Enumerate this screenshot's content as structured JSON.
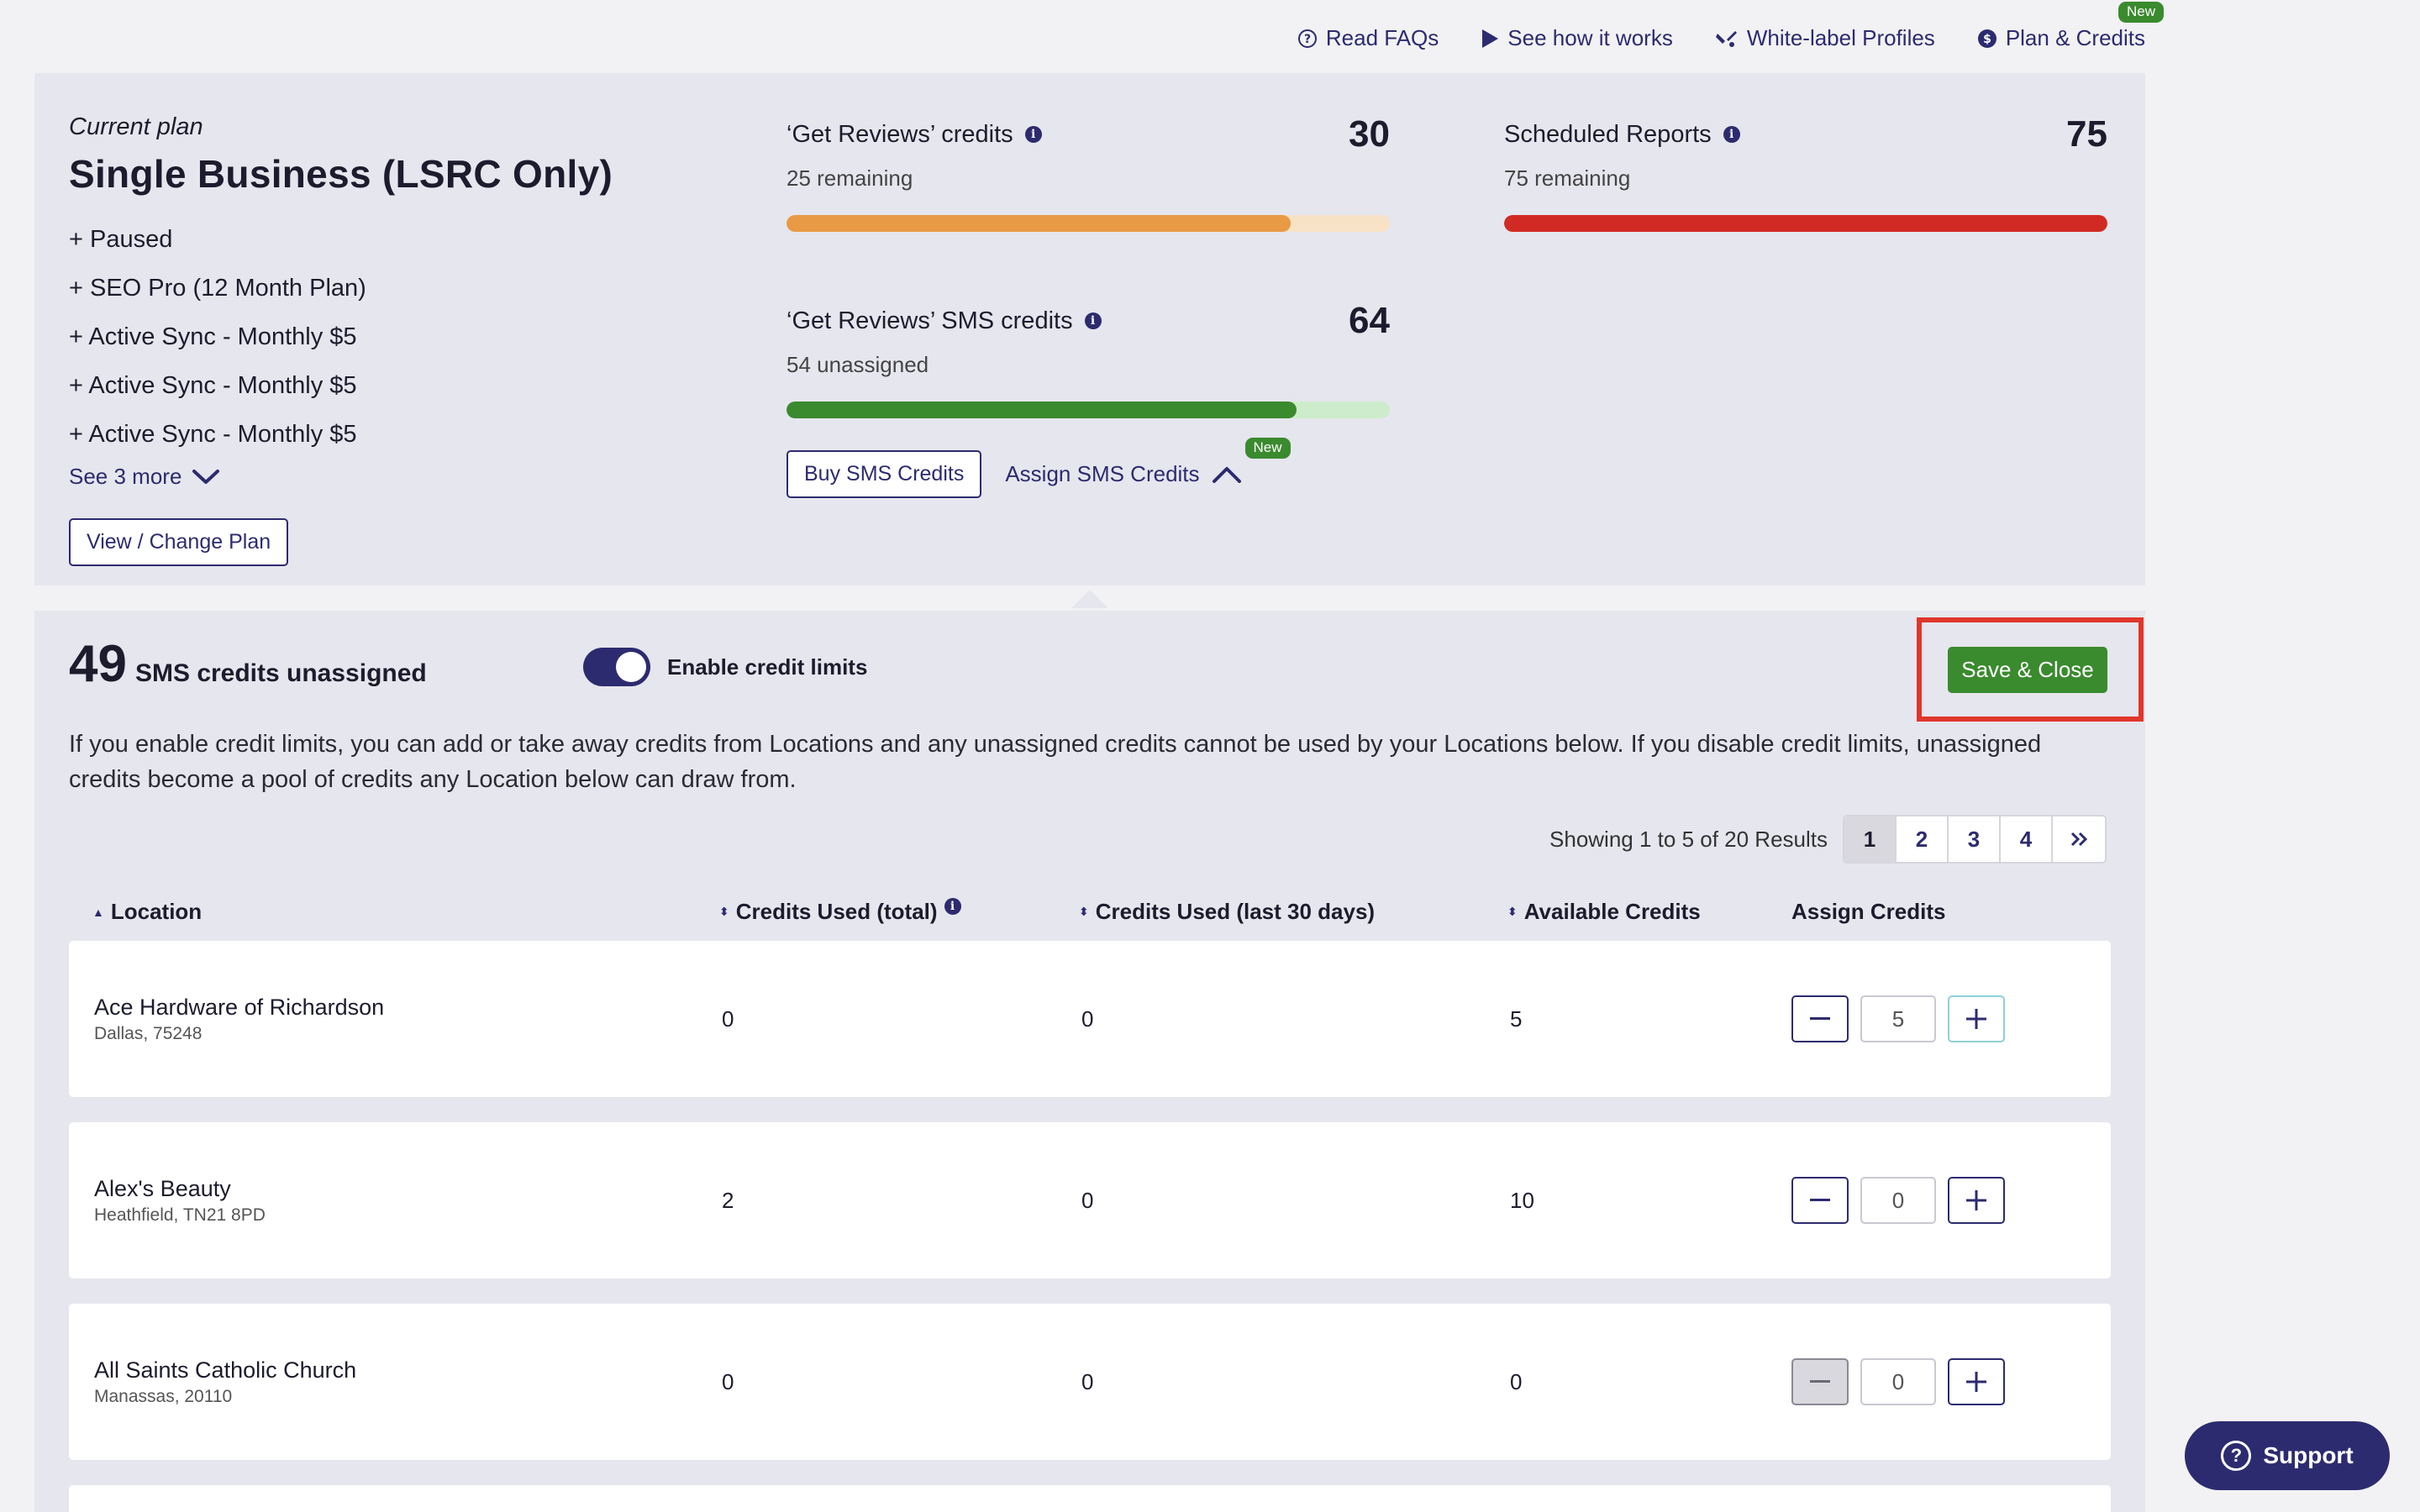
{
  "nav": {
    "read_faqs": "Read FAQs",
    "see_how": "See how it works",
    "white_label": "White-label Profiles",
    "plan_credits": "Plan & Credits",
    "new_badge": "New"
  },
  "plan": {
    "label": "Current plan",
    "name": "Single Business (LSRC Only)",
    "addons": [
      "+ Paused",
      "+ SEO Pro (12 Month Plan)",
      "+ Active Sync - Monthly $5",
      "+ Active Sync - Monthly $5",
      "+ Active Sync - Monthly $5"
    ],
    "see_more": "See 3 more",
    "change_button": "View / Change Plan"
  },
  "credits": {
    "reviews": {
      "title": "‘Get Reviews’ credits",
      "value": "30",
      "sub": "25 remaining",
      "fill": 0.835,
      "color": "#e89a45",
      "track": "#f7e2c6"
    },
    "sms": {
      "title": "‘Get Reviews’ SMS credits",
      "value": "64",
      "sub": "54 unassigned",
      "fill": 0.845,
      "color": "#3a8a2e",
      "track": "#cdeccb"
    },
    "reports": {
      "title": "Scheduled Reports",
      "value": "75",
      "sub": "75 remaining",
      "fill": 1.0,
      "color": "#d12a24",
      "track": "#f3c9c7"
    },
    "buy_sms": "Buy SMS Credits",
    "assign_sms": "Assign SMS Credits",
    "new_badge": "New"
  },
  "assign": {
    "count": "49",
    "count_label": "SMS credits unassigned",
    "toggle_label": "Enable credit limits",
    "toggle_on": true,
    "save_button": "Save & Close",
    "description": "If you enable credit limits, you can add or take away credits from Locations and any unassigned credits cannot be used by your Locations below. If you disable credit limits, unassigned credits become a pool of credits any Location below can draw from.",
    "results_text": "Showing 1 to 5 of 20 Results",
    "pages": [
      "1",
      "2",
      "3",
      "4"
    ],
    "active_page": "1",
    "columns": {
      "location": "Location",
      "used_total": "Credits Used (total)",
      "used_30": "Credits Used (last 30 days)",
      "available": "Available Credits",
      "assign": "Assign Credits"
    },
    "rows": [
      {
        "name": "Ace Hardware of Richardson",
        "address": "Dallas, 75248",
        "used_total": "0",
        "used_30": "0",
        "available": "5",
        "assign": "5"
      },
      {
        "name": "Alex's Beauty",
        "address": "Heathfield, TN21 8PD",
        "used_total": "2",
        "used_30": "0",
        "available": "10",
        "assign": "0"
      },
      {
        "name": "All Saints Catholic Church",
        "address": "Manassas, 20110",
        "used_total": "0",
        "used_30": "0",
        "available": "0",
        "assign": "0"
      }
    ]
  },
  "support": {
    "label": "Support"
  }
}
